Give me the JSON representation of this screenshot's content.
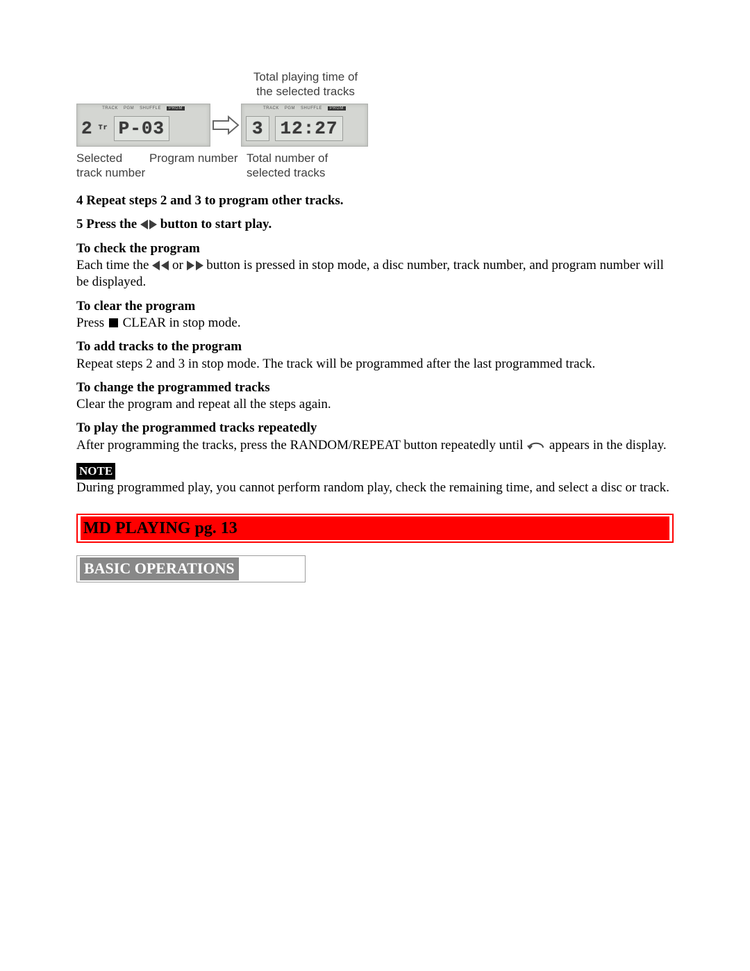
{
  "diagram": {
    "top_label_1": "Total playing time of",
    "top_label_2": "the selected tracks",
    "left_display_big_a": "2",
    "left_display_small_a": "Tr",
    "left_display_big_b": "P-03",
    "right_display_big_a": "3",
    "right_display_big_b": "12:27",
    "bottom_left_1": "Selected",
    "bottom_left_2": "track number",
    "bottom_mid": "Program number",
    "bottom_right_1": "Total number of",
    "bottom_right_2": "selected tracks",
    "lcd_tag_1": "TRACK",
    "lcd_tag_2": "PGM",
    "lcd_tag_3": "SHUFFLE",
    "lcd_tag_4": "PRGM"
  },
  "step4": "4  Repeat steps 2 and 3 to program other tracks.",
  "step5_a": "5  Press the",
  "step5_b": "button to start play.",
  "check": {
    "heading": "To check the program",
    "body_a": "Each time the",
    "body_b": "or",
    "body_c": "button is pressed in stop mode, a disc number, track number, and program number will be displayed."
  },
  "clear": {
    "heading": "To clear the program",
    "body_a": "Press",
    "body_b": "CLEAR in stop mode."
  },
  "add": {
    "heading": "To add tracks to the program",
    "body": "Repeat steps 2 and 3 in stop mode.  The track will be programmed after the last programmed track."
  },
  "change": {
    "heading": "To change the programmed tracks",
    "body": "Clear the program and repeat all the steps again."
  },
  "repeat": {
    "heading": "To play the programmed tracks repeatedly",
    "body_a": "After programming the tracks, press the RANDOM/REPEAT button repeatedly until",
    "body_b": "appears in the display."
  },
  "note": {
    "label": "NOTE",
    "body": "During programmed play, you cannot perform random play, check the remaining time, and select a disc or track."
  },
  "section_banner": "MD PLAYING pg. 13",
  "subheader": "BASIC OPERATIONS"
}
